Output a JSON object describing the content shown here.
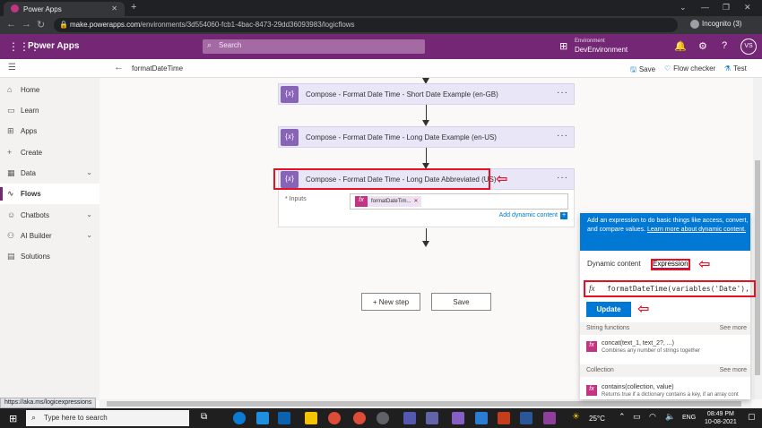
{
  "browser": {
    "tab_title": "Power Apps",
    "url_host": "make.powerapps.com",
    "url_path": "/environments/3d554060-fcb1-4bac-8473-29dd36093983/logicflows",
    "incognito_label": "Incognito (3)"
  },
  "app": {
    "name": "Power Apps",
    "search_placeholder": "Search",
    "environment_label": "Environment",
    "environment_name": "DevEnvironment",
    "user_initials": "VS"
  },
  "flow": {
    "name": "formatDateTime",
    "toolbar": {
      "save": "Save",
      "flow_checker": "Flow checker",
      "test": "Test"
    }
  },
  "sidebar": {
    "items": [
      {
        "label": "Home",
        "icon": "home-icon"
      },
      {
        "label": "Learn",
        "icon": "book-icon"
      },
      {
        "label": "Apps",
        "icon": "apps-icon"
      },
      {
        "label": "Create",
        "icon": "plus-icon"
      },
      {
        "label": "Data",
        "icon": "table-icon",
        "expandable": true
      },
      {
        "label": "Flows",
        "icon": "flow-icon",
        "active": true
      },
      {
        "label": "Chatbots",
        "icon": "chatbot-icon",
        "expandable": true
      },
      {
        "label": "AI Builder",
        "icon": "ai-icon",
        "expandable": true
      },
      {
        "label": "Solutions",
        "icon": "solutions-icon"
      }
    ]
  },
  "steps": [
    {
      "title": "Compose - Format Date Time - Short Date Example (en-GB)"
    },
    {
      "title": "Compose - Format Date Time - Long Date Example (en-US)"
    },
    {
      "title": "Compose - Format Date Time - Long Date Abbreviated (US)"
    }
  ],
  "step3": {
    "inputs_label": "* Inputs",
    "token_label": "formatDateTim...",
    "add_dynamic": "Add dynamic content"
  },
  "canvas_buttons": {
    "new_step": "+ New step",
    "save": "Save"
  },
  "panel": {
    "info_text": "Add an expression to do basic things like access, convert, and compare values.",
    "info_link": "Learn more about dynamic content.",
    "tab_dynamic": "Dynamic content",
    "tab_expression": "Expression",
    "expression": "formatDateTime(variables('Date'),'ddd,",
    "update_label": "Update",
    "sections": [
      {
        "title": "String functions",
        "more": "See more",
        "fn_name": "concat(text_1, text_2?, ...)",
        "fn_desc": "Combines any number of strings together"
      },
      {
        "title": "Collection",
        "more": "See more",
        "fn_name": "contains(collection, value)",
        "fn_desc": "Returns true if a dictionary contains a key, if an array cont"
      }
    ]
  },
  "status_url": "https://aka.ms/logicexpressions",
  "taskbar": {
    "search_placeholder": "Type here to search",
    "temperature": "25°C",
    "language": "ENG",
    "time": "08:49 PM",
    "date": "10-08-2021"
  },
  "colors": {
    "header": "#742774",
    "accent": "#0078d4",
    "annotation_red": "#e81123",
    "compose_icon": "#8764b8"
  }
}
